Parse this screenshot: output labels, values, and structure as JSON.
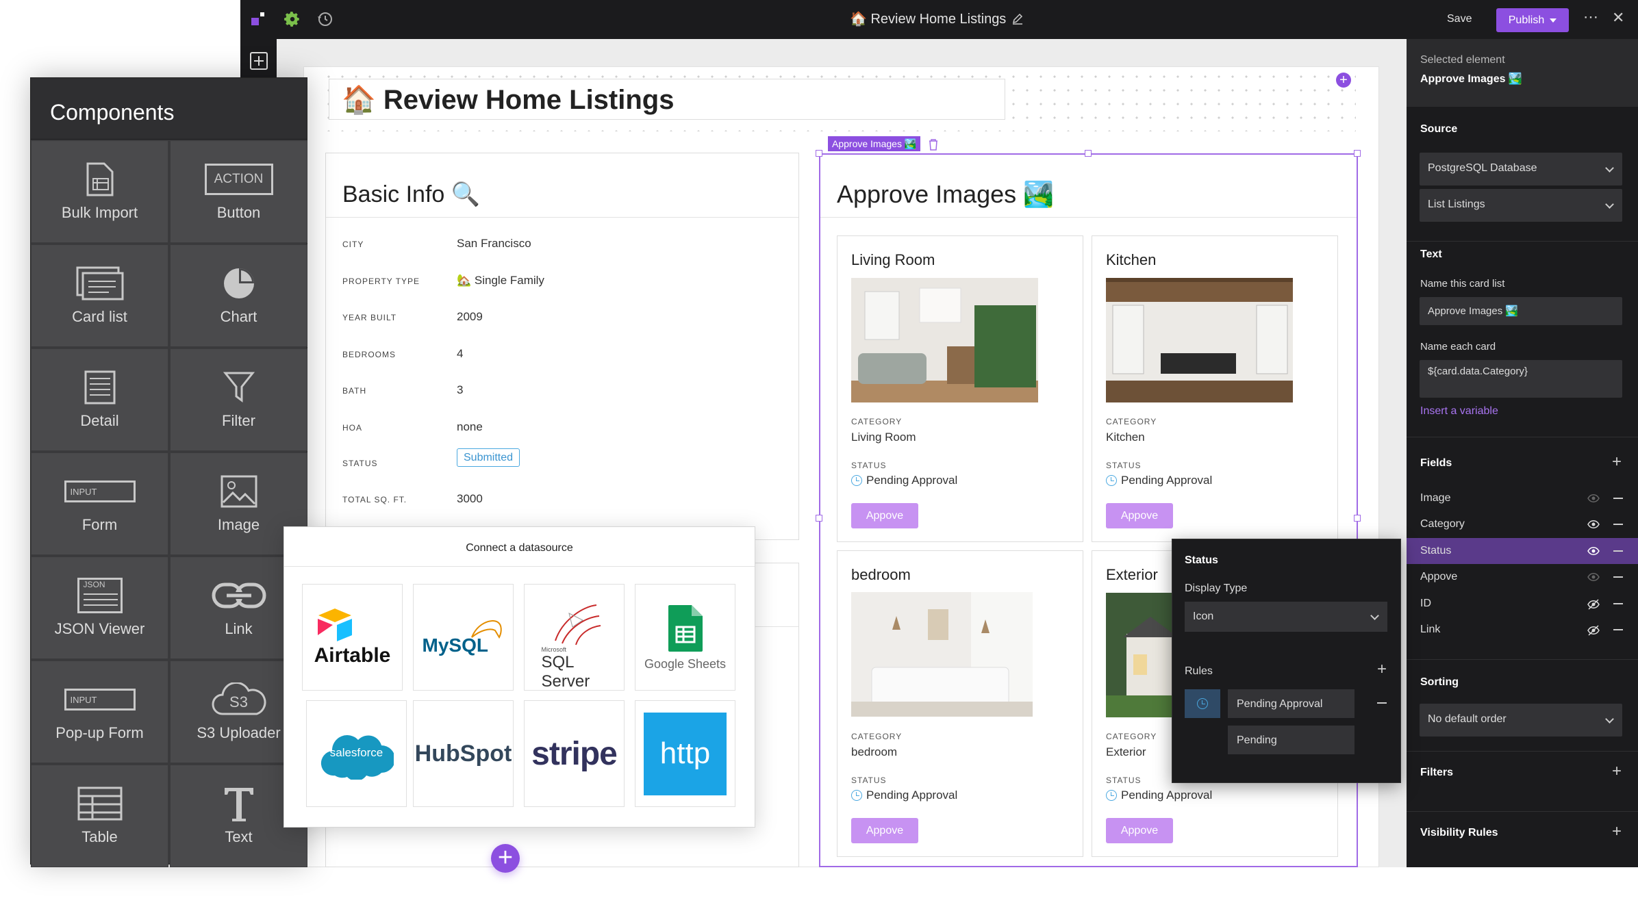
{
  "topbar": {
    "title": "🏠 Review Home Listings",
    "save_label": "Save",
    "publish_label": "Publish"
  },
  "page": {
    "title": "🏠 Review Home Listings"
  },
  "basic_info": {
    "title": "Basic Info 🔍",
    "rows": [
      {
        "label": "CITY",
        "value": "San Francisco"
      },
      {
        "label": "PROPERTY TYPE",
        "value": "🏡 Single Family"
      },
      {
        "label": "YEAR BUILT",
        "value": "2009"
      },
      {
        "label": "BEDROOMS",
        "value": "4"
      },
      {
        "label": "BATH",
        "value": "3"
      },
      {
        "label": "HOA",
        "value": "none"
      },
      {
        "label": "STATUS",
        "value": "Submitted"
      },
      {
        "label": "TOTAL SQ. FT.",
        "value": "3000"
      }
    ]
  },
  "approve": {
    "tag": "Approve Images 🏞️",
    "title": "Approve Images 🏞️",
    "category_label": "CATEGORY",
    "status_label": "STATUS",
    "button_label": "Appove",
    "cards": [
      {
        "title": "Living Room",
        "category": "Living Room",
        "status": "Pending Approval"
      },
      {
        "title": "Kitchen",
        "category": "Kitchen",
        "status": "Pending Approval"
      },
      {
        "title": "bedroom",
        "category": "bedroom",
        "status": "Pending Approval"
      },
      {
        "title": "Exterior",
        "category": "Exterior",
        "status": "Pending Approval"
      }
    ]
  },
  "components": {
    "title": "Components",
    "items": [
      {
        "label": "Bulk Import",
        "icon": "bulk-import-icon"
      },
      {
        "label": "Button",
        "icon": "button-icon",
        "badge": "ACTION"
      },
      {
        "label": "Card list",
        "icon": "card-list-icon"
      },
      {
        "label": "Chart",
        "icon": "chart-icon"
      },
      {
        "label": "Detail",
        "icon": "detail-icon"
      },
      {
        "label": "Filter",
        "icon": "filter-icon"
      },
      {
        "label": "Form",
        "icon": "form-icon",
        "badge": "INPUT"
      },
      {
        "label": "Image",
        "icon": "image-icon"
      },
      {
        "label": "JSON Viewer",
        "icon": "json-icon",
        "badge": "JSON"
      },
      {
        "label": "Link",
        "icon": "link-icon"
      },
      {
        "label": "Pop-up Form",
        "icon": "popup-form-icon",
        "badge": "INPUT"
      },
      {
        "label": "S3 Uploader",
        "icon": "s3-icon",
        "badge": "S3"
      },
      {
        "label": "Table",
        "icon": "table-icon"
      },
      {
        "label": "Text",
        "icon": "text-icon"
      }
    ]
  },
  "datasource": {
    "title": "Connect a datasource",
    "items": [
      "Airtable",
      "MySQL",
      "SQL Server",
      "Google Sheets",
      "salesforce",
      "HubSpot",
      "stripe",
      "http"
    ],
    "sql_server_small": "Microsoft"
  },
  "right_panel": {
    "selected_label": "Selected element",
    "selected_value": "Approve Images 🏞️",
    "source_heading": "Source",
    "source_db": "PostgreSQL Database",
    "source_query": "List Listings",
    "text_heading": "Text",
    "name_card_list_label": "Name this card list",
    "name_card_list_value": "Approve Images 🏞️",
    "name_each_card_label": "Name each card",
    "name_each_card_value": "${card.data.Category}",
    "insert_variable": "Insert a variable",
    "fields_heading": "Fields",
    "fields": [
      {
        "name": "Image",
        "visibility": "visible-dim"
      },
      {
        "name": "Category",
        "visibility": "visible"
      },
      {
        "name": "Status",
        "visibility": "visible"
      },
      {
        "name": "Appove",
        "visibility": "visible-dim"
      },
      {
        "name": "ID",
        "visibility": "hidden"
      },
      {
        "name": "Link",
        "visibility": "hidden"
      }
    ],
    "sorting_heading": "Sorting",
    "sorting_value": "No default order",
    "filters_heading": "Filters",
    "visibility_heading": "Visibility Rules"
  },
  "status_popover": {
    "title": "Status",
    "display_type_label": "Display Type",
    "display_type_value": "Icon",
    "rules_label": "Rules",
    "rule_value": "Pending Approval",
    "rule_display": "Pending"
  },
  "colors": {
    "accent": "#8c4fe0",
    "button": "#c792f2",
    "status_blue": "#4aa8e0",
    "dark": "#1b1b1d"
  }
}
